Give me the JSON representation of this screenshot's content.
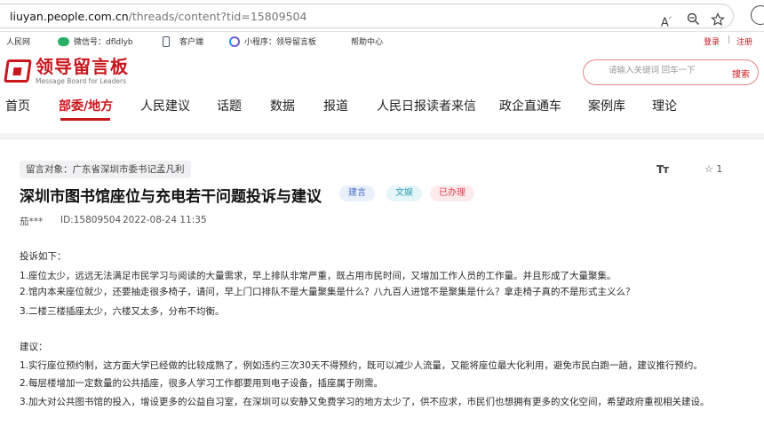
{
  "browser": {
    "url_host": "liuyan.people.com.cn",
    "url_path": "/threads/content?tid=15809504",
    "read_aloud_icon": "read-aloud-icon",
    "zoom_icon": "zoom-icon",
    "favorite_icon": "favorite-star-icon"
  },
  "topbar": {
    "site_name": "人民网",
    "wechat_label": "微信号：dfldlyb",
    "client_label": "客户端",
    "miniprogram_label": "小程序：领导留言板",
    "help_label": "帮助中心",
    "login_label": "登录",
    "separator": "|",
    "register_label": "注册"
  },
  "logo": {
    "cn": "领导留言板",
    "en": "Message Board for Leaders"
  },
  "search": {
    "placeholder": "请输入关键词 回车一下",
    "button_label": "搜索"
  },
  "nav": {
    "items": [
      "首页",
      "部委/地方",
      "人民建议",
      "话题",
      "数据",
      "报道",
      "人民日报读者来信",
      "政企直通车",
      "案例库",
      "理论"
    ],
    "active_index": 1
  },
  "post": {
    "recipient": "留言对象：广东省深圳市委书记孟凡利",
    "font_size_icon_label": "Tт",
    "favorite_label": "☆ 1",
    "title": "深圳市图书馆座位与充电若干问题投诉与建议",
    "tags": [
      "建言",
      "文娱",
      "已办理"
    ],
    "author": "茄***",
    "id_label": "ID:15809504",
    "date": "2022-08-24 11:35",
    "body": [
      "投诉如下：",
      "1.座位太少，远远无法满足市民学习与阅读的大量需求，早上排队非常严重，既占用市民时间，又增加工作人员的工作量。并且形成了大量聚集。",
      "2.馆内本来座位就少，还要抽走很多椅子，请问，早上门口排队不是大量聚集是什么？八九百人进馆不是聚集是什么？拿走椅子真的不是形式主义么？",
      "3.二楼三楼插座太少，六楼又太多，分布不均衡。",
      "建议：",
      "1.实行座位预约制，这方面大学已经做的比较成熟了，例如违约三次30天不得预约，既可以减少人流量，又能将座位最大化利用，避免市民白跑一趟，建议推行预约。",
      "2.每层楼增加一定数量的公共插座，很多人学习工作都要用到电子设备，插座属于刚需。",
      "3.加大对公共图书馆的投入，增设更多的公益自习室，在深圳可以安静又免费学习的地方太少了，供不应求，市民们也想拥有更多的文化空间，希望政府重视相关建设。"
    ]
  },
  "colors": {
    "brand_red": "#c8161d",
    "tag_blue": "#4a72c4",
    "tag_teal": "#2a9fb3",
    "tag_red": "#d9414b"
  }
}
